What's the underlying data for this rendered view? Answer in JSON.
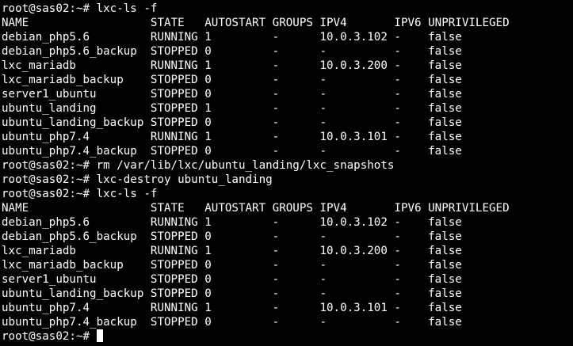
{
  "terminal": {
    "lines": [
      "root@sas02:~# lxc-ls -f",
      "NAME                  STATE   AUTOSTART GROUPS IPV4       IPV6 UNPRIVILEGED",
      "debian_php5.6         RUNNING 1         -      10.0.3.102 -    false",
      "debian_php5.6_backup  STOPPED 0         -      -          -    false",
      "lxc_mariadb           RUNNING 1         -      10.0.3.200 -    false",
      "lxc_mariadb_backup    STOPPED 0         -      -          -    false",
      "server1_ubuntu        STOPPED 0         -      -          -    false",
      "ubuntu_landing        STOPPED 1         -      -          -    false",
      "ubuntu_landing_backup STOPPED 0         -      -          -    false",
      "ubuntu_php7.4         RUNNING 1         -      10.0.3.101 -    false",
      "ubuntu_php7.4_backup  STOPPED 0         -      -          -    false",
      "root@sas02:~# rm /var/lib/lxc/ubuntu_landing/lxc_snapshots",
      "root@sas02:~# lxc-destroy ubuntu_landing",
      "root@sas02:~# lxc-ls -f",
      "NAME                  STATE   AUTOSTART GROUPS IPV4       IPV6 UNPRIVILEGED",
      "debian_php5.6         RUNNING 1         -      10.0.3.102 -    false",
      "debian_php5.6_backup  STOPPED 0         -      -          -    false",
      "lxc_mariadb           RUNNING 1         -      10.0.3.200 -    false",
      "lxc_mariadb_backup    STOPPED 0         -      -          -    false",
      "server1_ubuntu        STOPPED 0         -      -          -    false",
      "ubuntu_landing_backup STOPPED 0         -      -          -    false",
      "ubuntu_php7.4         RUNNING 1         -      10.0.3.101 -    false",
      "ubuntu_php7.4_backup  STOPPED 0         -      -          -    false"
    ],
    "prompt": "root@sas02:~# ",
    "colors": {
      "background": "#000000",
      "foreground": "#ffffff"
    }
  }
}
